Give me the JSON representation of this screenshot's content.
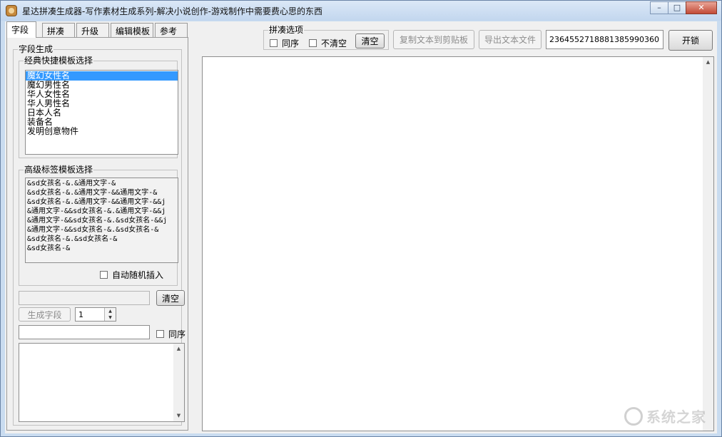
{
  "window": {
    "title": "星达拼凑生成器-写作素材生成系列-解决小说创作-游戏制作中需要费心思的东西"
  },
  "tabs": [
    {
      "label": "字段",
      "active": true
    },
    {
      "label": "拼凑",
      "active": false
    },
    {
      "label": "升级",
      "active": false
    },
    {
      "label": "编辑模板",
      "active": false
    },
    {
      "label": "参考",
      "active": false
    }
  ],
  "field_panel": {
    "group_title": "字段生成",
    "classic": {
      "title": "经典快捷模板选择",
      "items": [
        "魔幻女性名",
        "魔幻男性名",
        "华人女性名",
        "华人男性名",
        "日本人名",
        "装备名",
        "发明创意物件"
      ],
      "selected": "魔幻女性名"
    },
    "advanced": {
      "title": "高级标签模板选择",
      "lines": [
        "&sd女孩名-&.&通用文字-&",
        "&sd女孩名-&.&通用文字-&&通用文字-&",
        "&sd女孩名-&.&通用文字-&&通用文字-&&j",
        "&通用文字-&&sd女孩名-&.&通用文字-&&j",
        "&通用文字-&&sd女孩名-&.&sd女孩名-&&j",
        "&通用文字-&&sd女孩名-&.&sd女孩名-&",
        "&sd女孩名-&.&sd女孩名-&",
        "&sd女孩名-&"
      ],
      "auto_insert_label": "自动随机插入"
    },
    "template_input": "",
    "clear_label": "清空",
    "generate_label": "生成字段",
    "count_value": "1",
    "filter_input": "",
    "same_order_label": "同序"
  },
  "top_options": {
    "group_title": "拼凑选项",
    "same_order_label": "同序",
    "no_clear_label": "不清空",
    "clear_label": "清空",
    "copy_label": "复制文本到剪贴板",
    "export_label": "导出文本文件",
    "serial": "2364552718881385990360",
    "unlock_label": "开锁"
  },
  "watermark": {
    "text": "系统之家"
  }
}
